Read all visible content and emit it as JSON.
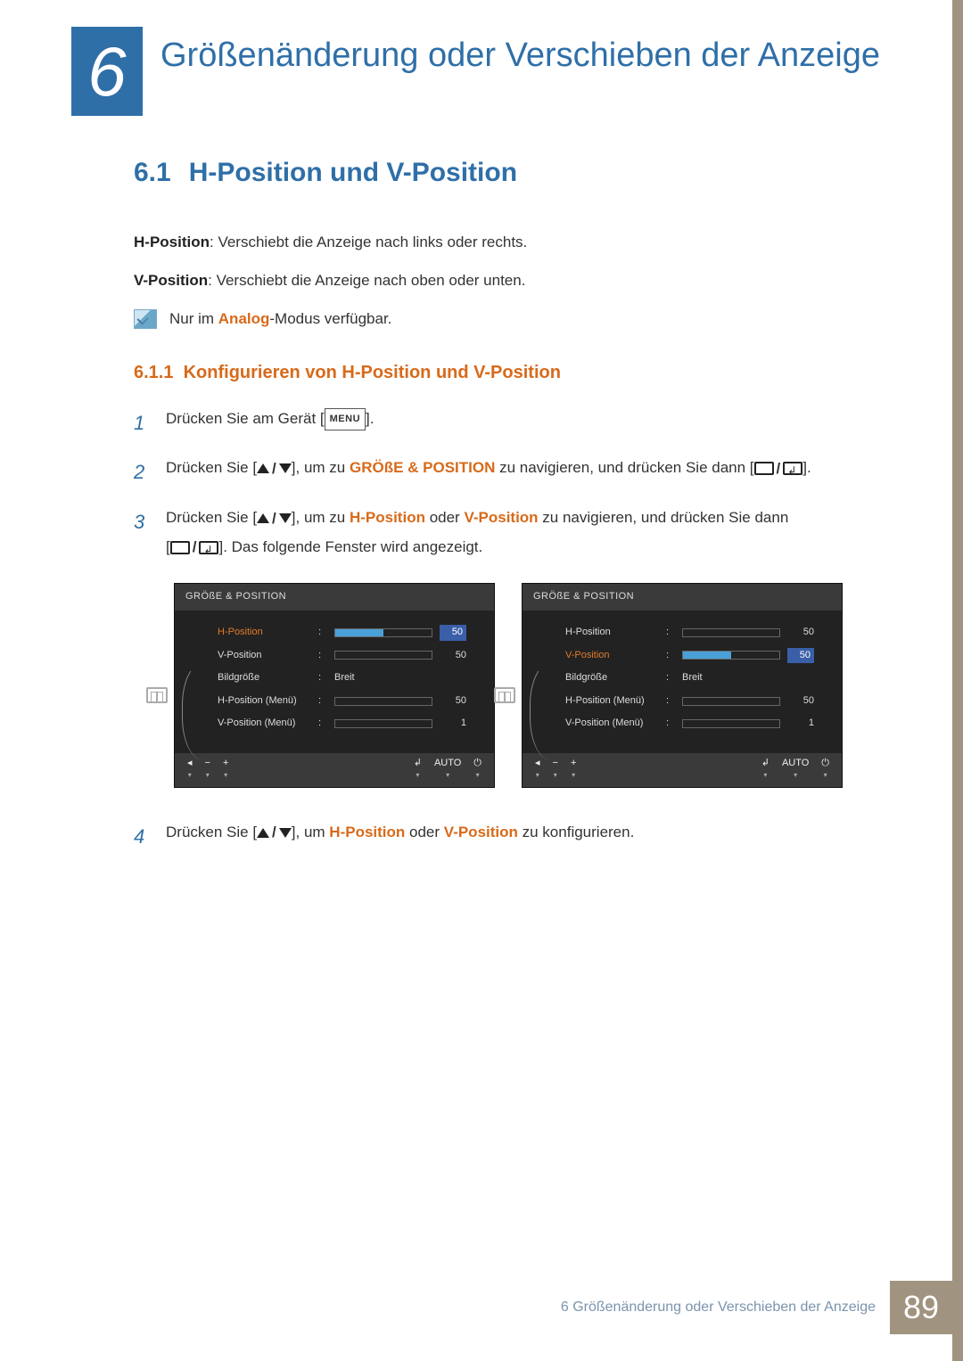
{
  "chapter": {
    "number": "6",
    "title": "Größenänderung oder Verschieben der Anzeige"
  },
  "section": {
    "number": "6.1",
    "title": "H-Position und V-Position"
  },
  "intro": {
    "h_label": "H-Position",
    "h_desc": ": Verschiebt die Anzeige nach links oder rechts.",
    "v_label": "V-Position",
    "v_desc": ": Verschiebt die Anzeige nach oben oder unten.",
    "note_pre": "Nur im ",
    "note_bold": "Analog",
    "note_post": "-Modus verfügbar."
  },
  "subsection": {
    "number": "6.1.1",
    "title": "Konfigurieren von H-Position und V-Position"
  },
  "steps": {
    "s1_num": "1",
    "s1_pre": "Drücken Sie am Gerät [",
    "s1_menu": "MENU",
    "s1_post": "].",
    "s2_num": "2",
    "s2_pre": "Drücken Sie [",
    "s2_mid1": "], um zu ",
    "s2_target": "GRÖßE & POSITION",
    "s2_mid2": " zu navigieren, und drücken Sie dann [",
    "s2_post": "].",
    "s3_num": "3",
    "s3_pre": "Drücken Sie [",
    "s3_mid1": "], um zu ",
    "s3_t1": "H-Position",
    "s3_or": " oder ",
    "s3_t2": "V-Position",
    "s3_mid2": " zu navigieren, und drücken Sie dann",
    "s3_line2_pre": "[",
    "s3_line2_post": "]. Das folgende Fenster wird angezeigt.",
    "s4_num": "4",
    "s4_pre": "Drücken Sie [",
    "s4_mid": "], um ",
    "s4_t1": "H-Position",
    "s4_or": " oder ",
    "s4_t2": "V-Position",
    "s4_post": " zu konfigurieren."
  },
  "osd": {
    "title": "GRÖßE & POSITION",
    "items": {
      "hpos": "H-Position",
      "vpos": "V-Position",
      "bild": "Bildgröße",
      "hmenu": "H-Position (Menü)",
      "vmenu": "V-Position (Menü)"
    },
    "values": {
      "fifty": "50",
      "one": "1",
      "breit": "Breit"
    },
    "footer": {
      "auto": "AUTO"
    }
  },
  "footer": {
    "text": "6 Größenänderung oder Verschieben der Anzeige",
    "page": "89"
  }
}
